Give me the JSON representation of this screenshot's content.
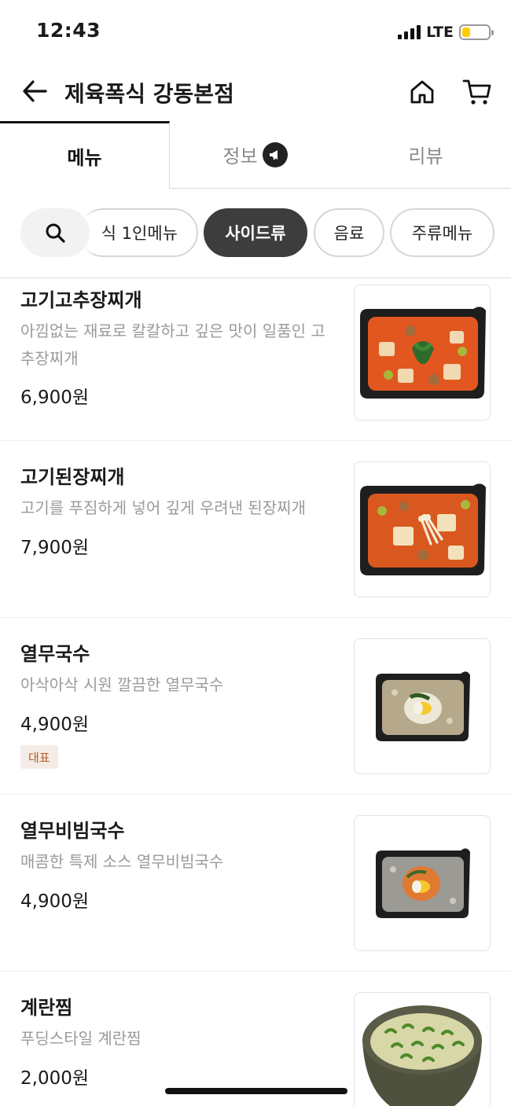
{
  "status_bar": {
    "time": "12:43",
    "network": "LTE",
    "battery_level": 0.3,
    "battery_color": "#ffcc00"
  },
  "header": {
    "title": "제육폭식 강동본점",
    "back_icon": "arrow-left-icon",
    "home_icon": "home-icon",
    "cart_icon": "cart-icon"
  },
  "tabs": [
    {
      "label": "메뉴",
      "active": true
    },
    {
      "label": "정보",
      "active": false,
      "badge_icon": "megaphone-icon"
    },
    {
      "label": "리뷰",
      "active": false
    }
  ],
  "categories": {
    "search_icon": "search-icon",
    "chips": [
      {
        "label": "식 1인메뉴",
        "active": false
      },
      {
        "label": "사이드류",
        "active": true
      },
      {
        "label": "음료",
        "active": false
      },
      {
        "label": "주류메뉴",
        "active": false
      }
    ]
  },
  "menu_items": [
    {
      "name": "고기고추장찌개",
      "description": "아낌없는 재료로 칼칼하고 깊은 맛이 일품인 고추장찌개",
      "price": "6,900원",
      "image_icon": "stew-container-image"
    },
    {
      "name": "고기된장찌개",
      "description": "고기를 푸짐하게 넣어 깊게 우려낸 된장찌개",
      "price": "7,900원",
      "image_icon": "stew-container-image"
    },
    {
      "name": "열무국수",
      "description": "아삭아삭 시원 깔끔한 열무국수",
      "price": "4,900원",
      "tag": "대표",
      "image_icon": "cold-noodle-container-image"
    },
    {
      "name": "열무비빔국수",
      "description": "매콤한 특제 소스 열무비빔국수",
      "price": "4,900원",
      "image_icon": "spicy-noodle-container-image"
    },
    {
      "name": "계란찜",
      "description": "푸딩스타일 계란찜",
      "price": "2,000원",
      "image_icon": "steamed-egg-bowl-image"
    }
  ],
  "colors": {
    "accent_dark": "#3d3d3d",
    "tag_bg": "#f4ece6",
    "tag_text": "#b45f2a",
    "muted_text": "#9a9a9a"
  }
}
